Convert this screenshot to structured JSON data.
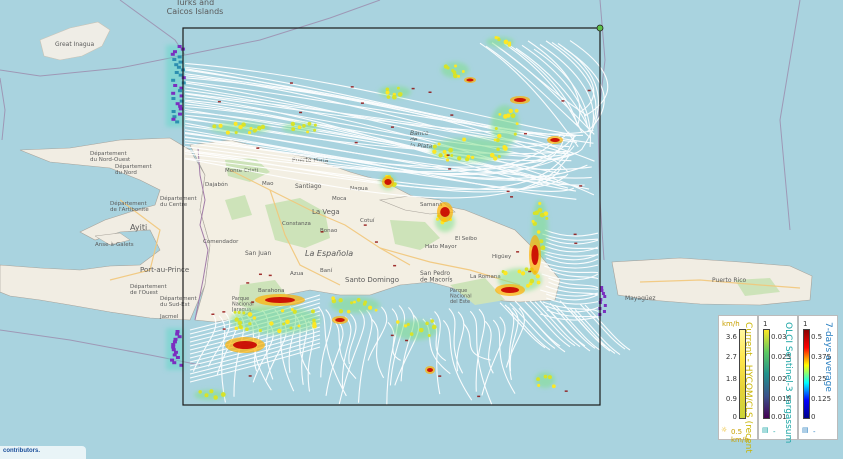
{
  "map": {
    "labels": {
      "turks_caicos": "Turks and\nCaicos Islands",
      "great_inagua": "Great Inagua",
      "haiti": "Ayiti",
      "haiti_nord": "Département\ndu Nord",
      "haiti_nordouest": "Département\ndu Nord-Ouest",
      "haiti_artibonite": "Département\nde l'Artibonite",
      "haiti_centre": "Département\ndu Centre",
      "haiti_ouest": "Département\nde l'Ouest",
      "haiti_sud": "Département\ndu Sud-Est",
      "port_au_prince": "Port-au-Prince",
      "anse_a_galets": "Anse-à-Galets",
      "dominican": "La Española",
      "la_vega": "La Vega",
      "santo_domingo": "Santo Domingo",
      "san_pedro": "San Pedro\nde Macorís",
      "santiago": "Santiago",
      "puerto_plata": "Puerto Plata",
      "san_juan": "San Juan",
      "parque_jaragua": "Parque\nNacional\nJaragua",
      "parque_este": "Parque\nNacional\ndel Este",
      "mayaguez": "Mayagüez",
      "puerto_rico": "Puerto Rico",
      "nagua": "Nagua",
      "montecristi": "Monte Cristi",
      "dajabon": "Dajabón",
      "mao": "Mao",
      "moca": "Moca",
      "bonao": "Bonao",
      "azua": "Azua",
      "bani": "Baní",
      "higuey": "Higüey",
      "la_romana": "La Romana",
      "samana": "Samaná",
      "el_seibo": "El Seibo",
      "hato_mayor": "Hato Mayor",
      "cotui": "Cotuí",
      "comendador": "Comendador",
      "barahona": "Barahona",
      "jacmel": "Jacmel",
      "constanza": "Constanza",
      "banco_plata": "Banco\nde\nla Plata"
    },
    "attribution": "contributors."
  },
  "legends": [
    {
      "title": "Current - HYCOM/CLS (recent",
      "unit": "km/h",
      "ticks": [
        "3.6",
        "2.7",
        "1.8",
        "0.9",
        "0"
      ],
      "footer": "0.5 km/h",
      "colors": [
        "#fff7a0",
        "#ffe74a",
        "#e6d23a",
        "#cbd53a"
      ]
    },
    {
      "title": "OLCI Sentinel-3 sargassum",
      "unit": "1",
      "ticks": [
        "0.03",
        "0.025",
        "0.02",
        "0.015",
        "0.01"
      ],
      "footer": "-",
      "colors": [
        "#fde725",
        "#5ec962",
        "#21918c",
        "#3b528b",
        "#440154"
      ]
    },
    {
      "title": "7-days average",
      "unit": "1",
      "ticks": [
        "0.5",
        "0.375",
        "0.25",
        "0.125",
        "0"
      ],
      "footer": "-",
      "colors": [
        "#8b0000",
        "#ff0000",
        "#ffff00",
        "#00ffff",
        "#0000ff",
        "#00008b"
      ]
    }
  ]
}
